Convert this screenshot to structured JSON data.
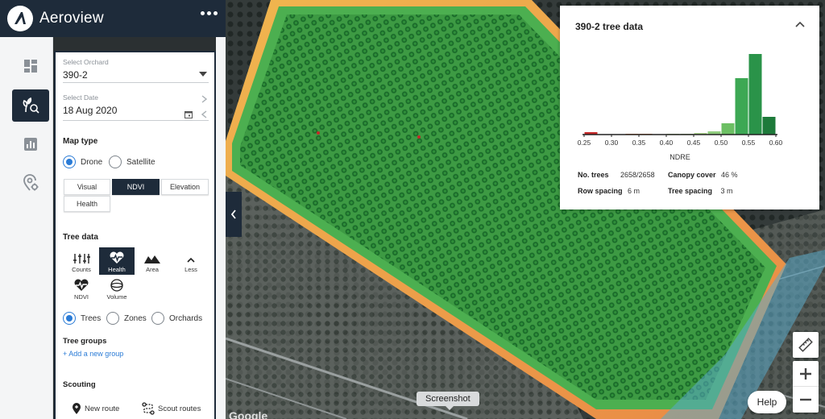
{
  "app": {
    "title": "Aeroview"
  },
  "rail": {
    "items": [
      {
        "icon": "dashboard-icon"
      },
      {
        "icon": "plant-search-icon",
        "active": true
      },
      {
        "icon": "bar-chart-icon"
      },
      {
        "icon": "location-settings-icon"
      }
    ]
  },
  "panel": {
    "orchard": {
      "label": "Select Orchard",
      "value": "390-2"
    },
    "date": {
      "label": "Select Date",
      "value": "18 Aug 2020"
    },
    "map_type": {
      "title": "Map type",
      "source_options": [
        "Drone",
        "Satellite"
      ],
      "selected_source": "Drone",
      "layers": [
        "Visual",
        "NDVI",
        "Elevation",
        "Health"
      ],
      "selected_layer": "NDVI"
    },
    "tree_data": {
      "title": "Tree data",
      "tools": [
        "Counts",
        "Health",
        "Area",
        "Less",
        "NDVI",
        "Volume"
      ],
      "selected_tool": "Health",
      "scope_options": [
        "Trees",
        "Zones",
        "Orchards"
      ],
      "selected_scope": "Trees"
    },
    "tree_groups": {
      "title": "Tree groups",
      "add_link": "+ Add a new group"
    },
    "scouting": {
      "title": "Scouting",
      "new_route": "New route",
      "scout_routes": "Scout routes"
    }
  },
  "card": {
    "title": "390-2 tree data",
    "stats": {
      "no_trees_label": "No. trees",
      "no_trees_value": "2658/2658",
      "canopy_label": "Canopy cover",
      "canopy_value": "46 %",
      "row_spacing_label": "Row spacing",
      "row_spacing_value": "6 m",
      "tree_spacing_label": "Tree spacing",
      "tree_spacing_value": "3 m"
    }
  },
  "chart_data": {
    "type": "bar",
    "title": "",
    "xlabel": "NDRE",
    "ylabel": "",
    "xlim": [
      0.25,
      0.6
    ],
    "x_ticks": [
      "0.25",
      "0.30",
      "0.35",
      "0.40",
      "0.45",
      "0.50",
      "0.55",
      "0.60"
    ],
    "bins": [
      {
        "x0": 0.25,
        "x1": 0.275,
        "value": 3,
        "color": "#c62828"
      },
      {
        "x0": 0.325,
        "x1": 0.35,
        "value": 1,
        "color": "#e8874a"
      },
      {
        "x0": 0.35,
        "x1": 0.375,
        "value": 1,
        "color": "#e8874a"
      },
      {
        "x0": 0.4,
        "x1": 0.425,
        "value": 1,
        "color": "#a9c98a"
      },
      {
        "x0": 0.425,
        "x1": 0.45,
        "value": 1,
        "color": "#a9c98a"
      },
      {
        "x0": 0.45,
        "x1": 0.475,
        "value": 2,
        "color": "#a9d38c"
      },
      {
        "x0": 0.475,
        "x1": 0.5,
        "value": 4,
        "color": "#8fcc7d"
      },
      {
        "x0": 0.5,
        "x1": 0.525,
        "value": 14,
        "color": "#6cbf63"
      },
      {
        "x0": 0.525,
        "x1": 0.55,
        "value": 70,
        "color": "#3da854"
      },
      {
        "x0": 0.55,
        "x1": 0.575,
        "value": 100,
        "color": "#2a9349"
      },
      {
        "x0": 0.575,
        "x1": 0.6,
        "value": 22,
        "color": "#1d7a3a"
      }
    ]
  },
  "map": {
    "tooltip": "Screenshot",
    "help_label": "Help",
    "watermark": "Google",
    "controls": [
      "ruler-icon",
      "zoom-in-icon",
      "zoom-out-icon"
    ]
  },
  "colors": {
    "navy": "#1e2b3a",
    "accent_blue": "#2a7bd6"
  }
}
